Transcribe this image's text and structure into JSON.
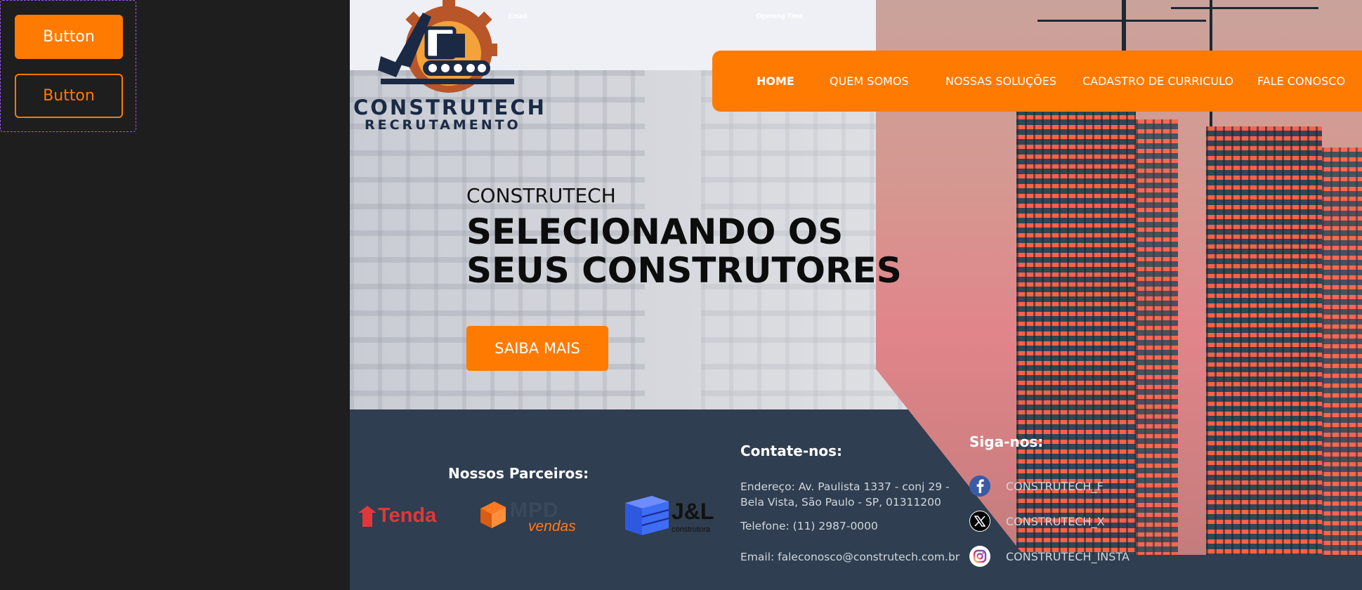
{
  "component_panel": {
    "primary_button_label": "Button",
    "outline_button_label": "Button"
  },
  "topbar": {
    "email_label": "Email",
    "opening_time_label": "Opening Time"
  },
  "brand": {
    "name": "CONSTRUTECH",
    "tagline": "RECRUTAMENTO"
  },
  "nav": {
    "items": [
      {
        "label": "HOME",
        "active": true
      },
      {
        "label": "QUEM SOMOS",
        "active": false
      },
      {
        "label": "NOSSAS SOLUÇÕES",
        "active": false
      },
      {
        "label": "CADASTRO DE CURRICULO",
        "active": false
      },
      {
        "label": "FALE CONOSCO",
        "active": false
      }
    ]
  },
  "hero": {
    "eyebrow": "CONSTRUTECH",
    "title_line1": "SELECIONANDO OS",
    "title_line2": "SEUS CONSTRUTORES",
    "cta_label": "SAIBA MAIS"
  },
  "partners": {
    "heading": "Nossos Parceiros:",
    "logos": [
      {
        "name": "Tenda"
      },
      {
        "name": "MPD",
        "sub": "vendas"
      },
      {
        "name": "J&L",
        "sub": "construtora"
      }
    ]
  },
  "contact": {
    "heading": "Contate-nos:",
    "address_line1": "Endereço: Av. Paulista 1337 - conj 29 -",
    "address_line2": "Bela Vista, São Paulo - SP, 01311200",
    "phone": "Telefone: (11) 2987-0000",
    "email": "Email: faleconosco@construtech.com.br"
  },
  "social": {
    "heading": "Siga-nos:",
    "items": [
      {
        "icon": "facebook-icon",
        "label": "CONSTRUTECH_F"
      },
      {
        "icon": "x-icon",
        "label": "CONSTRUTECH_X"
      },
      {
        "icon": "instagram-icon",
        "label": "CONSTRUTECH_INSTA"
      }
    ]
  },
  "colors": {
    "accent": "#ff7a00",
    "footer_bg": "#2f3e50",
    "brand_navy": "#1a2a45",
    "panel_bg": "#1e1e1e",
    "variant_border": "#9b59f5"
  }
}
